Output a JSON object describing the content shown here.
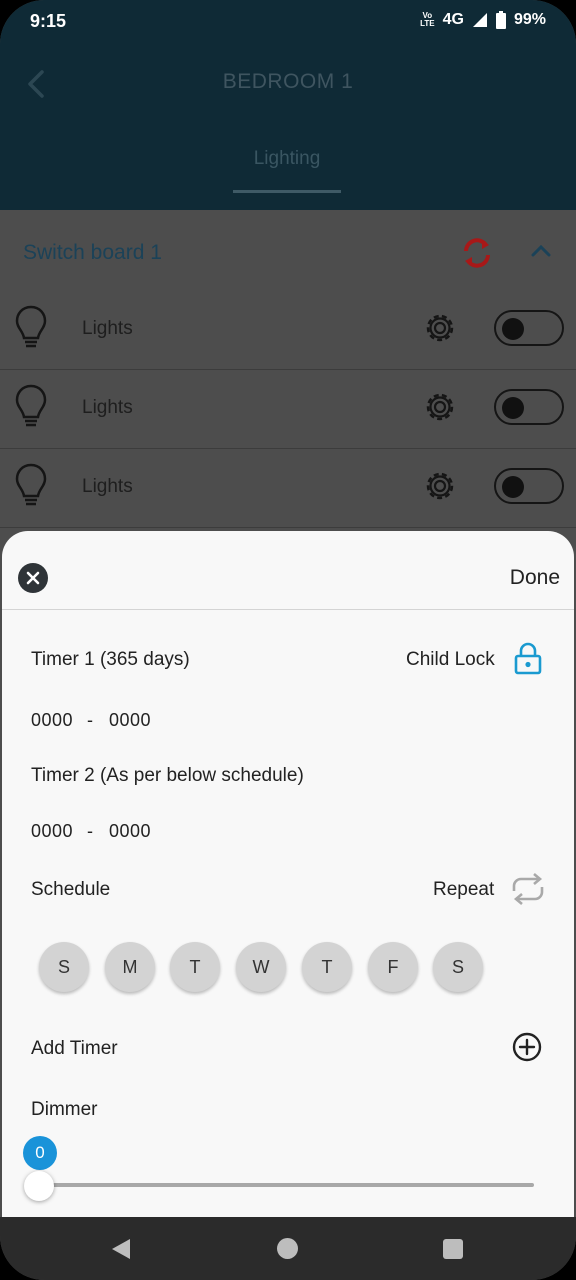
{
  "status": {
    "time": "9:15",
    "network": "4G",
    "battery": "99%",
    "volte": "Vo\nLTE"
  },
  "header": {
    "title": "BEDROOM 1",
    "tab": "Lighting"
  },
  "board": {
    "name": "Switch board 1"
  },
  "lights": [
    {
      "label": "Lights",
      "on": false
    },
    {
      "label": "Lights",
      "on": false
    },
    {
      "label": "Lights",
      "on": false
    }
  ],
  "sheet": {
    "done_label": "Done",
    "timer1_label": "Timer 1 (365 days)",
    "child_lock_label": "Child Lock",
    "timer1_start": "0000",
    "timer1_sep": "-",
    "timer1_end": "0000",
    "timer2_label": "Timer 2 (As per below schedule)",
    "timer2_start": "0000",
    "timer2_sep": "-",
    "timer2_end": "0000",
    "schedule_label": "Schedule",
    "repeat_label": "Repeat",
    "days": [
      "S",
      "M",
      "T",
      "W",
      "T",
      "F",
      "S"
    ],
    "add_timer_label": "Add Timer",
    "dimmer_label": "Dimmer",
    "dimmer_value": "0"
  },
  "colors": {
    "header_bg": "#0f2a36",
    "accent_blue": "#1a93d9",
    "sync_red": "#c01a1a",
    "lock_blue": "#1a9ad0"
  }
}
